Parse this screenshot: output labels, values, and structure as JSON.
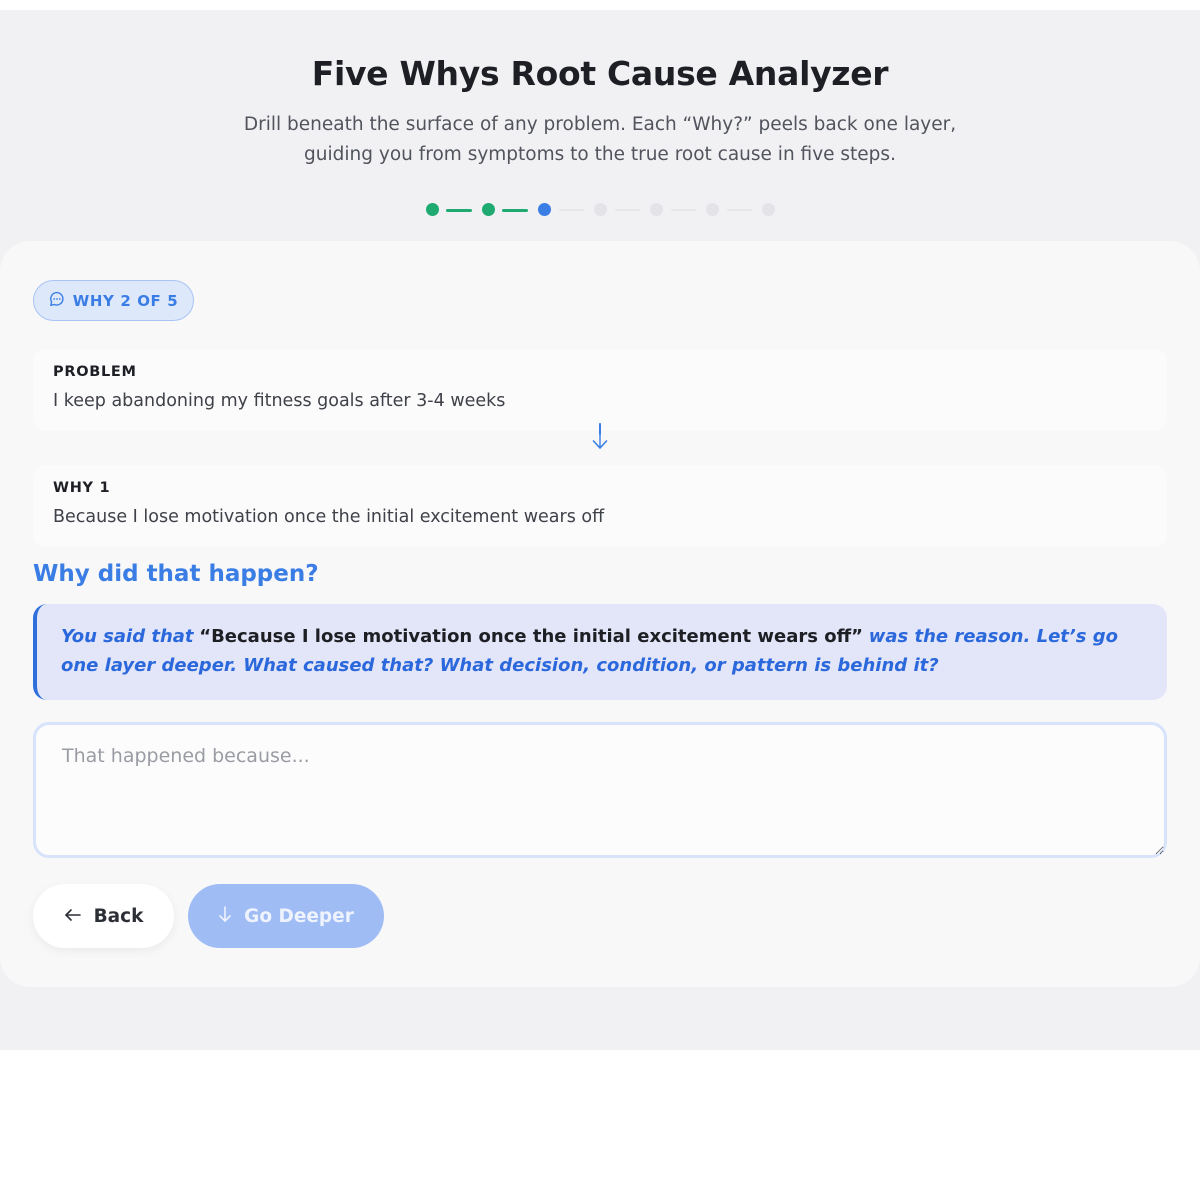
{
  "header": {
    "title": "Five Whys Root Cause Analyzer",
    "subtitle": "Drill beneath the surface of any problem. Each “Why?” peels back one layer, guiding you from symptoms to the true root cause in five steps."
  },
  "progress": {
    "total_steps": 7,
    "completed_steps": 2,
    "current_step": 3,
    "colors": {
      "done": "#1faa72",
      "current": "#3a7de5",
      "todo": "#e4e4e8"
    }
  },
  "badge": {
    "icon": "chat-bubble-icon",
    "label": "WHY 2 OF 5"
  },
  "history": [
    {
      "label": "PROBLEM",
      "text": "I keep abandoning my fitness goals after 3-4 weeks"
    },
    {
      "label": "WHY 1",
      "text": "Because I lose motivation once the initial excitement wears off"
    }
  ],
  "question": "Why did that happen?",
  "prompt": {
    "lead": "You said that",
    "quote": "“Because I lose motivation once the initial excitement wears off”",
    "follow": "was the reason. Let’s go one layer deeper. What caused that? What decision, condition, or pattern is behind it?"
  },
  "answer": {
    "value": "",
    "placeholder": "That happened because..."
  },
  "buttons": {
    "back_label": "Back",
    "back_icon": "arrow-left-icon",
    "deeper_label": "Go Deeper",
    "deeper_icon": "arrow-down-icon"
  },
  "colors": {
    "accent": "#3a7de5",
    "success": "#1faa72",
    "background": "#f1f1f4"
  }
}
